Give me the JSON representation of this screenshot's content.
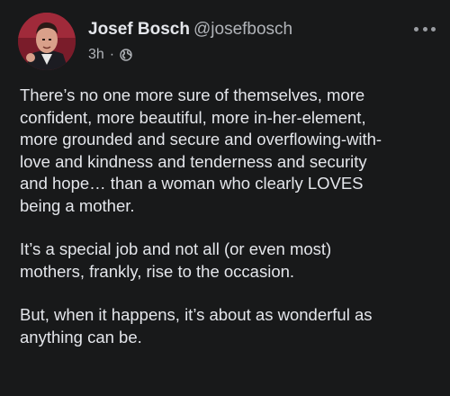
{
  "author": {
    "name": "Josef Bosch",
    "handle": "@josefbosch"
  },
  "meta": {
    "time": "3h",
    "separator": "·",
    "visibility_icon": "globe-icon"
  },
  "actions": {
    "more_icon": "more-options-icon"
  },
  "post": {
    "paragraphs": [
      "There’s no one more sure of themselves, more\nconfident, more beautiful, more in-her-element,\nmore grounded and secure and overflowing-with-\nlove and kindness and tenderness and security\nand hope… than a woman who clearly LOVES\nbeing a mother.",
      "It’s a special job and not all (or even most)\nmothers, frankly, rise to the occasion.",
      "But, when it happens, it’s about as wonderful as\nanything can be."
    ]
  },
  "colors": {
    "background": "#18191a",
    "text": "#e4e6eb",
    "secondary_text": "#b0b3b8"
  }
}
